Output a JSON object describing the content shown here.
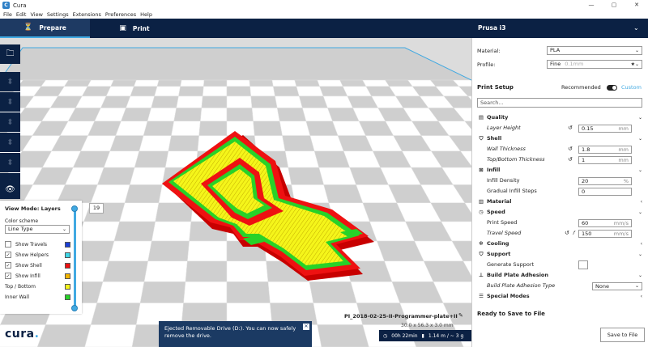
{
  "window": {
    "title": "Cura",
    "controls": [
      "—",
      "▢",
      "✕"
    ]
  },
  "menu": [
    "File",
    "Edit",
    "View",
    "Settings",
    "Extensions",
    "Preferences",
    "Help"
  ],
  "header": {
    "tab_prepare": "Prepare",
    "tab_print": "Print",
    "printer": "Prusa i3"
  },
  "layer_view": {
    "title": "View Mode: Layers",
    "scheme_label": "Color scheme",
    "scheme_value": "Line Type",
    "current_layer": "19",
    "rows": [
      {
        "label": "Show Travels",
        "checked": false,
        "color": "#1a3fd6"
      },
      {
        "label": "Show Helpers",
        "checked": true,
        "color": "#3fd6e6"
      },
      {
        "label": "Show Shell",
        "checked": true,
        "color": "#ee1111"
      },
      {
        "label": "Show Infill",
        "checked": true,
        "color": "#f2b400"
      },
      {
        "label": "Top / Bottom",
        "checked": null,
        "color": "#f5f51a"
      },
      {
        "label": "Inner Wall",
        "checked": null,
        "color": "#28d228"
      }
    ]
  },
  "logo": {
    "text": "cura",
    "dot": "."
  },
  "toast": {
    "message": "Ejected Removable Drive (D:). You can now safely remove the drive."
  },
  "job": {
    "name": "PI_2018-02-25-II-Programmer-plate+II",
    "dimensions": "30.0 x 56.3 x 3.0 mm",
    "time": "00h 22min",
    "material": "1.14 m / ~ 3 g"
  },
  "sidebar": {
    "material_label": "Material:",
    "material_value": "PLA",
    "profile_label": "Profile:",
    "profile_value": "Fine",
    "profile_hint": "0.1mm",
    "setup_title": "Print Setup",
    "mode_recommended": "Recommended",
    "mode_custom": "Custom",
    "search_placeholder": "Search...",
    "categories": {
      "quality": "Quality",
      "shell": "Shell",
      "infill": "Infill",
      "material": "Material",
      "speed": "Speed",
      "cooling": "Cooling",
      "support": "Support",
      "adhesion": "Build Plate Adhesion",
      "special": "Special Modes"
    },
    "settings": {
      "layer_height": {
        "label": "Layer Height",
        "value": "0.15",
        "unit": "mm"
      },
      "wall_thickness": {
        "label": "Wall Thickness",
        "value": "1.8",
        "unit": "mm"
      },
      "top_bottom": {
        "label": "Top/Bottom Thickness",
        "value": "1",
        "unit": "mm"
      },
      "infill_density": {
        "label": "Infill Density",
        "value": "20",
        "unit": "%"
      },
      "gradual_infill": {
        "label": "Gradual Infill Steps",
        "value": "0"
      },
      "print_speed": {
        "label": "Print Speed",
        "value": "60",
        "unit": "mm/s"
      },
      "travel_speed": {
        "label": "Travel Speed",
        "value": "150",
        "unit": "mm/s"
      },
      "generate_support": {
        "label": "Generate Support"
      },
      "adhesion_type": {
        "label": "Build Plate Adhesion Type",
        "value": "None"
      }
    },
    "ready": "Ready to Save to File",
    "save_button": "Save to File"
  },
  "colors": {
    "accent": "#41a9e2",
    "navy": "#0b2144"
  }
}
